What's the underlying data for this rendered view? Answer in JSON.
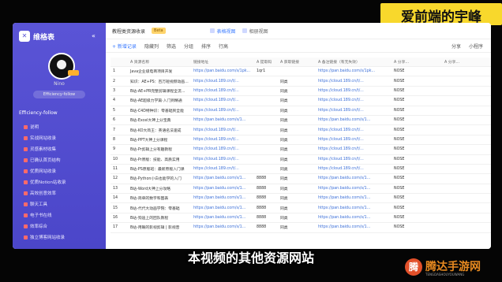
{
  "banner": {
    "text": "爱前端的宇峰"
  },
  "subtitle": {
    "text": "本视频的其他资源网站"
  },
  "watermark": {
    "icon": "腾",
    "text": "腾达手游网",
    "sub": "TENGDASHOUYOUWANG"
  },
  "app": {
    "logo": "维格表",
    "collapse_icon": "collapse-icon",
    "user": {
      "name": "Nino",
      "pill": "Efficiency-follow"
    },
    "workspace": "Efficiency-follow",
    "nav": [
      "说明",
      "实战网站收录",
      "灵感素材收集",
      "已确认首页结构",
      "优质网站收录",
      "优质Notion站收录",
      "高效创意效率",
      "聊天工具",
      "电子书在线",
      "效率综合",
      "独立博客网站收录"
    ]
  },
  "topbar": {
    "title": "教程类资源收录",
    "tag": "Beta",
    "tabs": [
      {
        "label": "表格视图",
        "active": true
      },
      {
        "label": "相册视图",
        "active": false
      }
    ]
  },
  "toolbar": {
    "add": "+ 新增记录",
    "items": [
      "隐藏列",
      "筛选",
      "分组",
      "排序",
      "行高"
    ],
    "right": [
      "分享",
      "小程序"
    ]
  },
  "table": {
    "headers": [
      "",
      "A 资源名称",
      "链接地址",
      "A 提取码",
      "A 获取链接",
      "A 备注链接（有无失效）",
      "A 分享…",
      "A 分享…"
    ],
    "rows": [
      [
        "1",
        "Java企业级电商项目开发",
        "https://pan.baidu.com/s/1pk...",
        "1qr1",
        "",
        "https://pan.baidu.com/s/1pk...",
        "NOSE",
        ""
      ],
      [
        "2",
        "知识：AE+PS：百万短视频动画制作",
        "https://cloud.189.cn/t/...",
        "",
        "同类",
        "https://cloud.189.cn/t/...",
        "NOSE",
        ""
      ],
      [
        "3",
        "B站-AE+PR完整剪辑课程全流程+素材",
        "https://cloud.189.cn/t/...",
        "",
        "同类",
        "https://cloud.189.cn/t/...",
        "NOSE",
        ""
      ],
      [
        "4",
        "B站-AE超级力学篇·入门到精通",
        "https://cloud.189.cn/t/...",
        "",
        "同类",
        "https://cloud.189.cn/t/...",
        "NOSE",
        ""
      ],
      [
        "5",
        "B站-C4D特种识：零基础到全能",
        "https://cloud.189.cn/t/...",
        "",
        "同类",
        "https://cloud.189.cn/t/...",
        "NOSE",
        ""
      ],
      [
        "6",
        "B站-Excel大神上分宝典",
        "https://pan.baidu.com/s/1...",
        "",
        "同类",
        "https://pan.baidu.com/s/1...",
        "NOSE",
        ""
      ],
      [
        "7",
        "B站-KO大简王：英语名法速成",
        "https://cloud.189.cn/t/...",
        "",
        "同类",
        "https://cloud.189.cn/t/...",
        "NOSE",
        ""
      ],
      [
        "8",
        "B站-PPT大神上分课程",
        "https://cloud.189.cn/t/...",
        "",
        "同类",
        "https://cloud.189.cn/t/...",
        "NOSE",
        ""
      ],
      [
        "9",
        "B站-Pr剪辑上分有趣教程",
        "https://cloud.189.cn/t/...",
        "",
        "同类",
        "https://cloud.189.cn/t/...",
        "NOSE",
        ""
      ],
      [
        "10",
        "B站-Pr原版：技能、高质实用",
        "https://cloud.189.cn/t/...",
        "",
        "同类",
        "https://cloud.189.cn/t/...",
        "NOSE",
        ""
      ],
      [
        "11",
        "B站-PS原版班：最新原版入门课",
        "https://cloud.189.cn/t/...",
        "",
        "同类",
        "https://cloud.189.cn/t/...",
        "NOSE",
        ""
      ],
      [
        "12",
        "B站-Python小白也能学的入门",
        "https://pan.baidu.com/s/1...",
        "8888",
        "同类",
        "https://pan.baidu.com/s/1...",
        "NOSE",
        ""
      ],
      [
        "13",
        "B站-Word大神上分攻略",
        "https://pan.baidu.com/s/1...",
        "8888",
        "同类",
        "https://pan.baidu.com/s/1...",
        "NOSE",
        ""
      ],
      [
        "14",
        "B站-简单的数字和图表",
        "https://pan.baidu.com/s/1...",
        "8888",
        "同类",
        "https://pan.baidu.com/s/1...",
        "NOSE",
        ""
      ],
      [
        "15",
        "B站-代代大动画学院：零基础",
        "https://pan.baidu.com/s/1...",
        "8888",
        "同类",
        "https://pan.baidu.com/s/1...",
        "NOSE",
        ""
      ],
      [
        "16",
        "B站-狗迪上的团队教程",
        "https://pan.baidu.com/s/1...",
        "8888",
        "同类",
        "https://pan.baidu.com/s/1...",
        "NOSE",
        ""
      ],
      [
        "17",
        "B站-用眼的影视剪辑 | 影视音",
        "https://pan.baidu.com/s/1...",
        "8888",
        "同类",
        "https://pan.baidu.com/s/1...",
        "NOSE",
        ""
      ]
    ]
  }
}
